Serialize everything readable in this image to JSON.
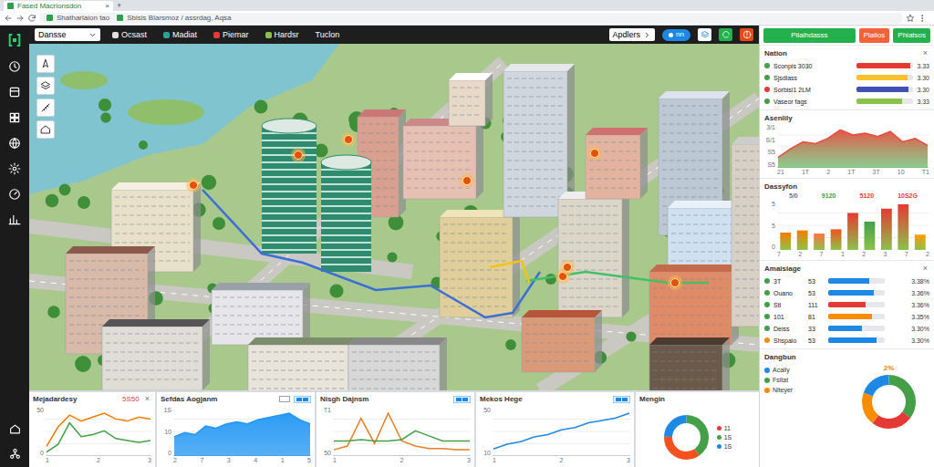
{
  "browser": {
    "tab_title": "Fased Macrionsdon",
    "tab_close": "×",
    "new_tab": "+",
    "address": "Shatharlaion tao",
    "path": "Sbisis Blarsmoz / assrdag, Aqsa"
  },
  "toolbar": {
    "dropdown": "Dansse",
    "tabs": [
      {
        "label": "Ocsast",
        "kind": "dot",
        "color": "#e0e0e0",
        "selected": false
      },
      {
        "label": "Madiat",
        "kind": "dot",
        "color": "#26a69a",
        "selected": false
      },
      {
        "label": "Piemar",
        "kind": "dot",
        "color": "#e53935",
        "selected": false
      },
      {
        "label": "Hardsr",
        "kind": "dot",
        "color": "#8bc34a",
        "selected": false
      },
      {
        "label": "Tuclon",
        "kind": "plain",
        "selected": false
      }
    ],
    "apply": "Apdlers",
    "pill": "nn"
  },
  "actions": [
    {
      "label": "Pilaihdasss",
      "color": "#22b14c"
    },
    {
      "label": "Plailos",
      "color": "#f4623a"
    },
    {
      "label": "Phiatsos",
      "color": "#22b14c"
    }
  ],
  "nation": {
    "title": "Nation",
    "close": "×",
    "rows": [
      {
        "label": "Sconpis 3030",
        "value": "3.33",
        "dot": "#43a047",
        "color": "#e53935",
        "level": 0.95
      },
      {
        "label": "Sjsdlass",
        "value": "3.30",
        "dot": "#43a047",
        "color": "#fbc02d",
        "level": 0.9
      },
      {
        "label": "Sorbisl1 2LM",
        "value": "3.30",
        "dot": "#e53935",
        "color": "#3f51b5",
        "level": 0.92
      },
      {
        "label": "Vaseor fags",
        "value": "3.33",
        "dot": "#43a047",
        "color": "#8bc34a",
        "level": 0.8
      }
    ]
  },
  "activity": {
    "title": "Asenlily",
    "y_ticks": [
      "3/1",
      "S/1",
      "S5",
      "S5"
    ],
    "x_ticks": [
      "21",
      "1T",
      "2",
      "1T",
      "3T",
      "10",
      "T1"
    ],
    "series": [
      {
        "values": [
          12,
          22,
          30,
          28,
          34,
          44,
          38,
          40,
          36,
          42,
          30,
          34,
          26
        ],
        "color": "#e74c3c"
      }
    ]
  },
  "distribution": {
    "title": "Dassyfon",
    "labels": [
      {
        "text": "5/0",
        "color": "#757575"
      },
      {
        "text": "9120",
        "color": "#43a047"
      },
      {
        "text": "5120",
        "color": "#e53935"
      },
      {
        "text": "10S2G",
        "color": "#e53935"
      }
    ],
    "y_ticks": [
      "5",
      "5",
      "0"
    ],
    "x_ticks": [
      "7",
      "2",
      "7",
      "1",
      "2",
      "3",
      "7",
      "2"
    ],
    "bars": [
      {
        "value": 3.2,
        "color": "#f57c00"
      },
      {
        "value": 3.6,
        "color": "#f57c00"
      },
      {
        "value": 3.0,
        "color": "#ff7043"
      },
      {
        "value": 3.8,
        "color": "#f4511e"
      },
      {
        "value": 6.8,
        "color": "#e53935"
      },
      {
        "value": 5.2,
        "color": "#43a047"
      },
      {
        "value": 7.6,
        "color": "#e53935"
      },
      {
        "value": 8.4,
        "color": "#e53935"
      },
      {
        "value": 2.8,
        "color": "#ff9800"
      }
    ]
  },
  "allocation": {
    "title": "Amaisiage",
    "close": "×",
    "rows": [
      {
        "label": "3T",
        "value": "53",
        "percent": "3.38%",
        "dot": "#43a047",
        "color": "#1e88e5",
        "level": 0.72
      },
      {
        "label": "Ouano",
        "value": "53",
        "percent": "3.36%",
        "dot": "#43a047",
        "color": "#1e88e5",
        "level": 0.8
      },
      {
        "label": "StI",
        "value": "111",
        "percent": "3.36%",
        "dot": "#43a047",
        "color": "#e53935",
        "level": 0.66
      },
      {
        "label": "101",
        "value": "81",
        "percent": "3.35%",
        "dot": "#43a047",
        "color": "#fb8c00",
        "level": 0.78
      },
      {
        "label": "Deiss",
        "value": "33",
        "percent": "3.30%",
        "dot": "#43a047",
        "color": "#1e88e5",
        "level": 0.6
      },
      {
        "label": "Shspaio",
        "value": "53",
        "percent": "3.30%",
        "dot": "#fb8c00",
        "color": "#1e88e5",
        "level": 0.85
      }
    ]
  },
  "breakdown": {
    "title": "Dangbun",
    "percent": "2%",
    "legend": [
      {
        "label": "Acaily",
        "color": "#1e88e5"
      },
      {
        "label": "Fsitat",
        "color": "#43a047"
      },
      {
        "label": "Niteyer",
        "color": "#fb8c00"
      }
    ],
    "segments": [
      {
        "value": 35,
        "color": "#43a047"
      },
      {
        "value": 25,
        "color": "#e53935"
      },
      {
        "value": 20,
        "color": "#fb8c00"
      },
      {
        "value": 20,
        "color": "#1e88e5"
      }
    ]
  },
  "panels": [
    {
      "title": "Mejadardesy",
      "kind": "line",
      "value": "5S50",
      "close": "×",
      "y_ticks": [
        "50",
        "0"
      ],
      "x_ticks": [
        "1",
        "2",
        "3"
      ],
      "series": [
        {
          "values": [
            10,
            30,
            42,
            36,
            40,
            44,
            38,
            36,
            40,
            38
          ],
          "color": "#f57c00"
        },
        {
          "values": [
            4,
            12,
            34,
            20,
            22,
            26,
            18,
            16,
            14,
            16
          ],
          "color": "#43a047"
        }
      ]
    },
    {
      "title": "Sefdas Aogjanm",
      "kind": "area",
      "y_ticks": [
        "1S",
        "10",
        "0"
      ],
      "x_ticks": [
        "2",
        "7",
        "3",
        "4",
        "1",
        "5"
      ],
      "series": [
        {
          "values": [
            18,
            22,
            20,
            28,
            26,
            30,
            32,
            30,
            34,
            36,
            38,
            40,
            34,
            30
          ],
          "color": "#2196f3"
        }
      ]
    },
    {
      "title": "Nisgh Dajnsm",
      "kind": "line",
      "y_ticks": [
        "T1",
        "50"
      ],
      "x_ticks": [
        "1",
        "2",
        "3"
      ],
      "series": [
        {
          "values": [
            5,
            8,
            30,
            10,
            34,
            12,
            8,
            6,
            6,
            5,
            5
          ],
          "color": "#e67e22"
        },
        {
          "values": [
            12,
            12,
            13,
            12,
            12,
            13,
            20,
            16,
            12,
            12,
            12
          ],
          "color": "#43a047"
        }
      ]
    },
    {
      "title": "Mekos Hege",
      "kind": "line",
      "y_ticks": [
        "50",
        "10"
      ],
      "x_ticks": [
        "1",
        "2",
        "3"
      ],
      "series": [
        {
          "values": [
            6,
            10,
            12,
            16,
            18,
            22,
            24,
            28,
            30,
            32,
            36
          ],
          "color": "#1e88e5"
        }
      ]
    },
    {
      "title": "Mengin",
      "kind": "donut",
      "legend": [
        {
          "label": "11",
          "color": "#e53935"
        },
        {
          "label": "1S",
          "color": "#43a047"
        },
        {
          "label": "1S",
          "color": "#1e88e5"
        }
      ],
      "segments": [
        {
          "value": 40,
          "color": "#43a047"
        },
        {
          "value": 35,
          "color": "#f4511e"
        },
        {
          "value": 25,
          "color": "#1e88e5"
        }
      ]
    }
  ]
}
